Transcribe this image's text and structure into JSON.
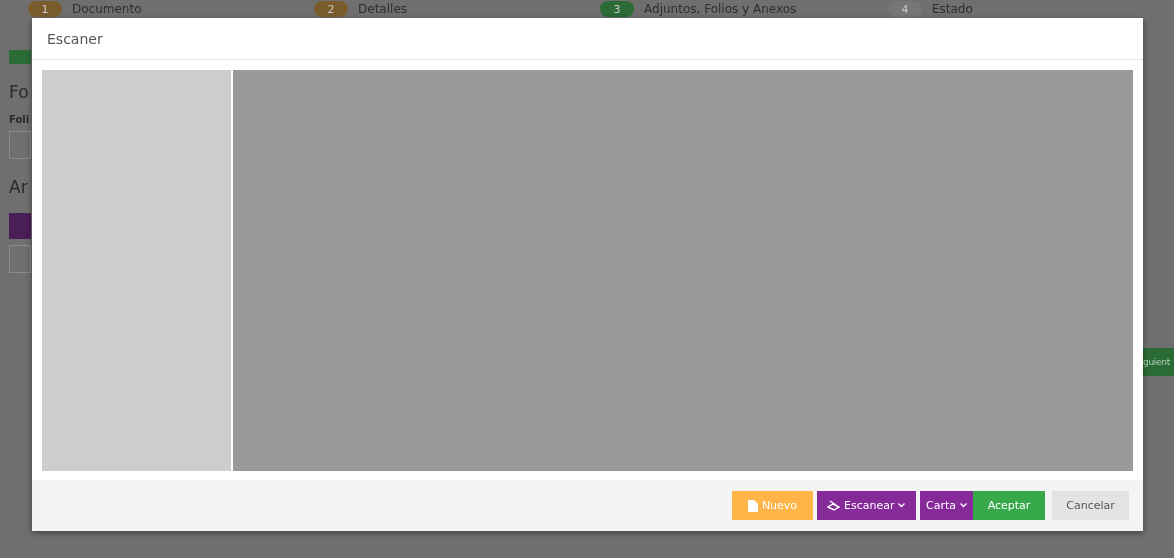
{
  "steps": [
    {
      "number": "1",
      "label": "Documento",
      "color": "#7a5c2c"
    },
    {
      "number": "2",
      "label": "Detalles",
      "color": "#7a5c2c"
    },
    {
      "number": "3",
      "label": "Adjuntos, Folios y Anexos",
      "color": "#2b6b36"
    },
    {
      "number": "4",
      "label": "Estado",
      "color": "#767676"
    }
  ],
  "background": {
    "section_1": "Fo",
    "field_label": "Foli",
    "section_2": "Ar",
    "next_button": "guient"
  },
  "dialog": {
    "title": "Escaner",
    "buttons": [
      {
        "kind": "new",
        "label": "Nuevo"
      },
      {
        "kind": "scan",
        "label": "Escanear"
      },
      {
        "kind": "paper",
        "label": "Carta"
      },
      {
        "kind": "accept",
        "label": "Aceptar"
      },
      {
        "kind": "cancel",
        "label": "Cancelar"
      }
    ]
  }
}
